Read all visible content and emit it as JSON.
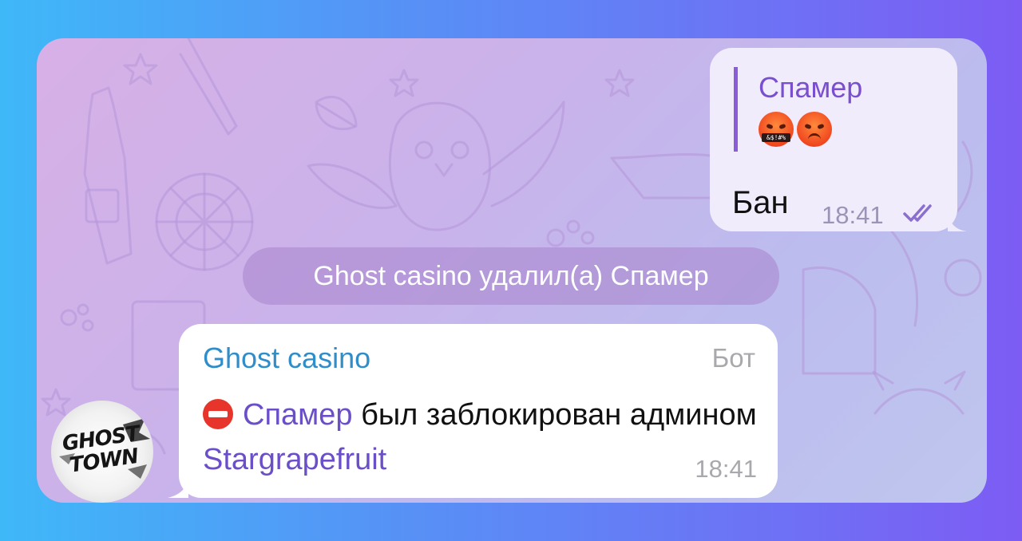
{
  "outgoing_message": {
    "reply_quote": {
      "author": "Спамер",
      "emoji": [
        "face-with-symbols-on-mouth",
        "angry-face"
      ],
      "censor_text": "&$!#%"
    },
    "text": "Бан",
    "time": "18:41",
    "status_icon": "double-check-icon"
  },
  "service_message": {
    "text": "Ghost casino удалил(а) Спамер"
  },
  "incoming_message": {
    "sender": "Ghost casino",
    "badge": "Бот",
    "icon": "no-entry-icon",
    "mention_user": "Спамер",
    "text_middle": " был заблокирован админом ",
    "mention_admin": "Stargrapefruit",
    "time": "18:41"
  },
  "avatar": {
    "line1": "GHOST",
    "line2": "TOWN"
  },
  "colors": {
    "frame_gradient": [
      "#3fb8f8",
      "#7d5cf4"
    ],
    "sender_name": "#2f8ec9",
    "mention": "#6b4fc8",
    "quote_accent": "#8a5cd8",
    "outgoing_bubble": "#f1ecfb"
  }
}
